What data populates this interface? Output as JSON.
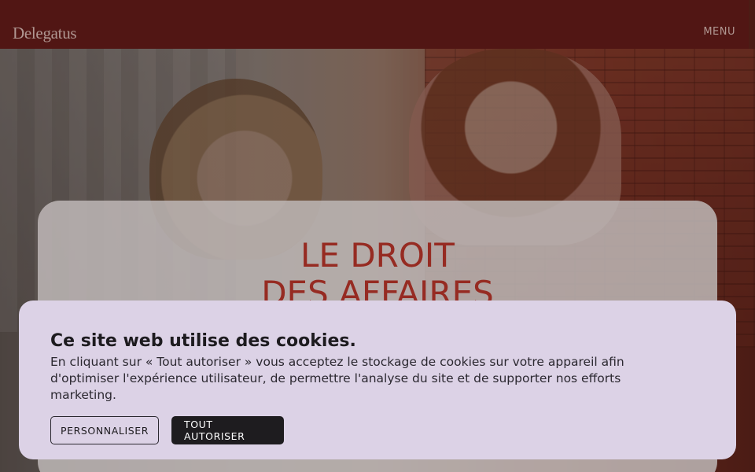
{
  "header": {
    "logo": "Delegatus",
    "menu_label": "MENU"
  },
  "hero": {
    "title_line1": "LE DROIT",
    "title_line2": "DES AFFAIRES"
  },
  "cookie_banner": {
    "title": "Ce site web utilise des cookies.",
    "text": "En cliquant sur « Tout autoriser » vous acceptez le stockage de cookies sur votre appareil afin d'optimiser l'expérience utilisateur, de permettre l'analyse du site et de supporter nos efforts marketing.",
    "customize_label": "PERSONNALISER",
    "accept_all_label": "TOUT AUTORISER"
  },
  "colors": {
    "header_bg": "#631c19",
    "accent_red": "#b8352a",
    "cookie_bg": "#dcd2e6",
    "button_dark": "#1e1c1f"
  }
}
